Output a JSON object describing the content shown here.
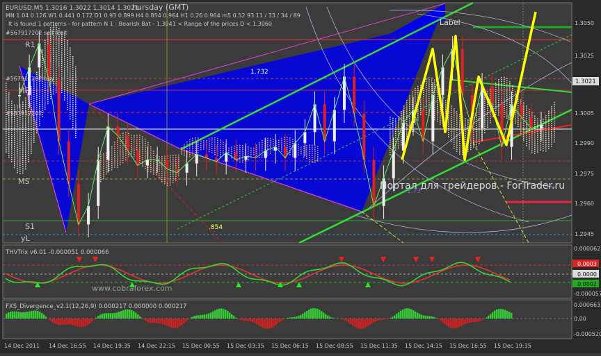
{
  "header": {
    "symbol_line": "EURUSD,M5  1.3016 1.3022 1.3014 1.3021",
    "day_label": "hursday  (GMT)",
    "timeframes_line": "MN 1.04  0.126  W1  0.441  0.172  D1  0.93  0.899  H4  0.854  0.964  H1  0.26  0.964  m5  0.52 93  11 / 33 / 34 / 89",
    "pattern_note": "It is found 1 patterns  -  for pattern N 1 - Bearish Bat - 1.3041 < Range of the prices D < 1.3060",
    "sell_limit": "#567917202 sell limit",
    "buy_tag": "#567917202 buy",
    "pos_tag": "#567917202"
  },
  "main_chart": {
    "pivot_labels": [
      "R1",
      "MR",
      "MS",
      "S1",
      "yL"
    ],
    "fib_labels": [
      "1.732",
      ".854",
      "1.73"
    ],
    "pattern_label": "Label",
    "current_price": "1.3021",
    "watermark_main": "Портал для трейдеров - ForTrader.ru",
    "colors": {
      "bullish_fill": "#0000ff",
      "harmonic_line": "#ffff00",
      "trend_line": "#33dd33",
      "grid": "#5a5a5a"
    }
  },
  "indicator1": {
    "title": "THVTrix v6.01 -0.000051 0.000066",
    "watermark": "www.cobraforex.com",
    "levels": [
      "0.000062",
      "0.0003",
      "0.0000",
      "0.0002",
      "-0.000057"
    ]
  },
  "indicator2": {
    "title": "FXS_Divergence_v2.1(12,26,9) 0.000217 0.000000 0.000217",
    "levels": [
      "0.000663",
      "0.00",
      "-0.000520"
    ]
  },
  "chart_data": {
    "type": "line",
    "title": "",
    "y_ticks": [
      "1.3050",
      "1.3025",
      "1.3005",
      "1.2990",
      "1.2975",
      "1.2960",
      "1.2945"
    ],
    "ylim": [
      1.294,
      1.307
    ],
    "x_ticks": [
      "14 Dec 2011",
      "14 Dec 16:55",
      "14 Dec 19:35",
      "14 Dec 22:15",
      "15 Dec 00:55",
      "15 Dec 03:35",
      "15 Dec 06:15",
      "15 Dec 08:55",
      "15 Dec 11:35",
      "15 Dec 14:15",
      "15 Dec 16:55",
      "15 Dec 19:35"
    ],
    "series": [
      {
        "name": "EURUSD",
        "values": [
          1.302,
          1.3035,
          1.3048,
          1.3028,
          1.2995,
          1.2972,
          1.295,
          1.296,
          1.2985,
          1.3003,
          1.2998,
          1.299,
          1.2982,
          1.2985,
          1.2985,
          1.298,
          1.2978,
          1.2983,
          1.2988,
          1.2986,
          1.2984,
          1.2989,
          1.2985,
          1.2987,
          1.2986,
          1.299,
          1.2992,
          1.2986,
          1.2994,
          1.3,
          1.3015,
          1.2995,
          1.3012,
          1.303,
          1.301,
          1.2985,
          1.296,
          1.2975,
          1.299,
          1.3005,
          1.3012,
          1.2995,
          1.302,
          1.3035,
          1.3045,
          1.302,
          1.3002,
          1.3025,
          1.3015,
          1.2992,
          1.3015,
          1.3008,
          1.3002,
          1.3004
        ]
      }
    ],
    "harmonic_pattern": {
      "name": "Bearish Bat",
      "values": [
        1.2985,
        1.3045,
        1.3,
        1.3052,
        1.2985,
        1.303,
        1.2993,
        1.3065
      ]
    }
  }
}
